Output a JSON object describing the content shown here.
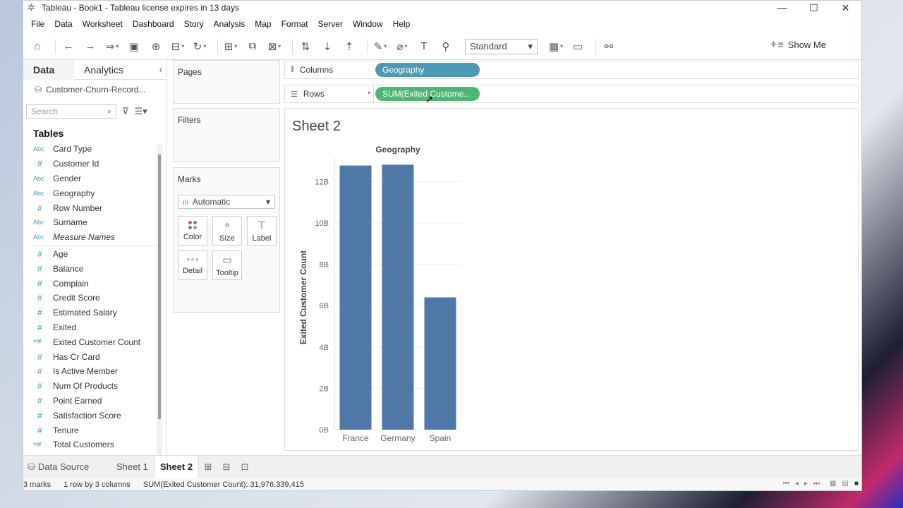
{
  "titlebar": {
    "title": "Tableau - Book1 - Tableau license expires in 13 days"
  },
  "menu": [
    "File",
    "Data",
    "Worksheet",
    "Dashboard",
    "Story",
    "Analysis",
    "Map",
    "Format",
    "Server",
    "Window",
    "Help"
  ],
  "toolbar": {
    "fit_select": "Standard",
    "show_me": "Show Me"
  },
  "data_pane": {
    "tabs": [
      "Data",
      "Analytics"
    ],
    "datasource": "Customer-Churn-Record...",
    "search_placeholder": "Search",
    "tables_heading": "Tables",
    "dimensions": [
      {
        "type": "Abc",
        "name": "Card Type"
      },
      {
        "type": "#",
        "name": "Customer Id"
      },
      {
        "type": "Abc",
        "name": "Gender"
      },
      {
        "type": "Abc",
        "name": "Geography"
      },
      {
        "type": "#",
        "name": "Row Number"
      },
      {
        "type": "Abc",
        "name": "Surname"
      },
      {
        "type": "Abc",
        "name": "Measure Names"
      }
    ],
    "measures": [
      {
        "type": "#",
        "name": "Age"
      },
      {
        "type": "#",
        "name": "Balance"
      },
      {
        "type": "#",
        "name": "Complain"
      },
      {
        "type": "#",
        "name": "Credit Score"
      },
      {
        "type": "#",
        "name": "Estimated Salary"
      },
      {
        "type": "#",
        "name": "Exited"
      },
      {
        "type": "=#",
        "name": "Exited Customer Count"
      },
      {
        "type": "#",
        "name": "Has Cr Card"
      },
      {
        "type": "#",
        "name": "Is Active Member"
      },
      {
        "type": "#",
        "name": "Num Of Products"
      },
      {
        "type": "#",
        "name": "Point Earned"
      },
      {
        "type": "#",
        "name": "Satisfaction Score"
      },
      {
        "type": "#",
        "name": "Tenure"
      },
      {
        "type": "=#",
        "name": "Total Customers"
      }
    ]
  },
  "cards": {
    "pages": "Pages",
    "filters": "Filters",
    "marks": "Marks",
    "marks_type": "Automatic",
    "mark_buttons": [
      "Color",
      "Size",
      "Label",
      "Detail",
      "Tooltip"
    ]
  },
  "shelves": {
    "columns_label": "Columns",
    "rows_label": "Rows",
    "columns_pill": "Geography",
    "rows_pill": "SUM(Exited Custome.."
  },
  "sheet": {
    "title": "Sheet 2"
  },
  "chart_data": {
    "type": "bar",
    "title": "Geography",
    "categories": [
      "France",
      "Germany",
      "Spain"
    ],
    "values": [
      12.78,
      12.82,
      6.4
    ],
    "value_unit": "B",
    "ylabel": "Exited Customer Count",
    "ylim": [
      0,
      12.8
    ],
    "yticks": [
      "0B",
      "2B",
      "4B",
      "6B",
      "8B",
      "10B",
      "12B"
    ],
    "ytick_values": [
      0,
      2,
      4,
      6,
      8,
      10,
      12
    ],
    "bar_color": "#4e79a7",
    "grid": true
  },
  "bottom_tabs": {
    "datasource": "Data Source",
    "sheets": [
      "Sheet 1",
      "Sheet 2"
    ]
  },
  "status": {
    "marks": "3 marks",
    "dims": "1 row by 3 columns",
    "sum": "SUM(Exited Customer Count): 31,976,339,415"
  },
  "colors": {
    "dimension_pill": "#4d99b4",
    "measure_pill": "#4fb574",
    "bar": "#4e79a7"
  }
}
